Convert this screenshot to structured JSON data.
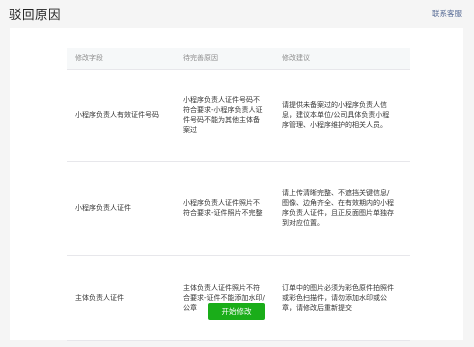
{
  "header": {
    "title": "驳回原因",
    "contact_link": "联系客服"
  },
  "table": {
    "columns": [
      "修改字段",
      "待完善原因",
      "修改建议"
    ],
    "rows": [
      {
        "field": "小程序负责人有效证件号码",
        "reason": "小程序负责人证件号码不符合要求-小程序负责人证件号码不能为其他主体备案过",
        "suggestion": "请提供未备案过的小程序负责人信息，建议本单位/公司具体负责小程序管理、小程序维护的相关人员。"
      },
      {
        "field": "小程序负责人证件",
        "reason": "小程序负责人证件照片不符合要求-证件照片不完整",
        "suggestion": "请上传清晰完整、不遮挡关键信息/图像、边角齐全、在有效期内的小程序负责人证件，且正反面图片单独存到对应位置。"
      },
      {
        "field": "主体负责人证件",
        "reason": "主体负责人证件照片不符合要求-证件不能添加水印/公章",
        "suggestion": "订单中的图片必须为彩色原件拍照件或彩色扫描件，请勿添加水印或公章，请修改后重新提交"
      }
    ]
  },
  "actions": {
    "start_edit": "开始修改"
  },
  "colors": {
    "primary": "#1aad19",
    "link": "#576b95",
    "table_header_bg": "#f6f8f9",
    "page_bg": "#f5f5f5"
  }
}
